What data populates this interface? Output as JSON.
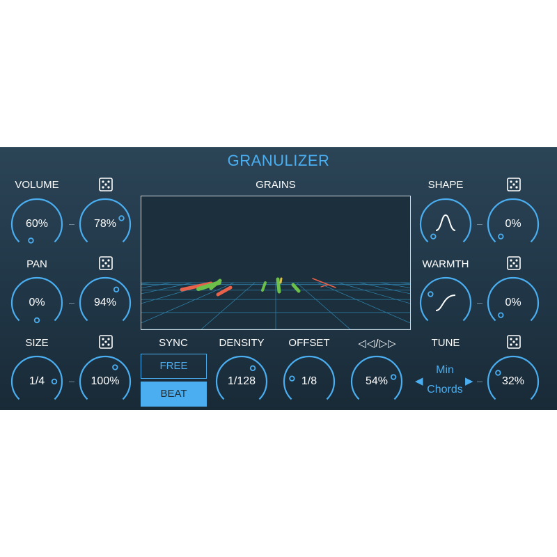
{
  "title": "GRANULIZER",
  "labels": {
    "volume": "VOLUME",
    "pan": "PAN",
    "size": "SIZE",
    "grains": "GRAINS",
    "shape": "SHAPE",
    "warmth": "WARMTH",
    "tune": "TUNE",
    "sync": "SYNC",
    "density": "DENSITY",
    "offset": "OFFSET",
    "direction": "◁◁/▷▷"
  },
  "knobs": {
    "volume": "60%",
    "volume_random": "78%",
    "pan": "0%",
    "pan_random": "94%",
    "size": "1/4",
    "size_random": "100%",
    "shape_random": "0%",
    "warmth_random": "0%",
    "tune_random": "32%",
    "density": "1/128",
    "offset": "1/8",
    "direction": "54%"
  },
  "sync": {
    "free": "FREE",
    "beat": "BEAT",
    "selected": "BEAT"
  },
  "tune": {
    "scale": "Min",
    "mode": "Chords"
  },
  "colors": {
    "accent": "#4aaef0",
    "background": "#22394a",
    "grain_green": "#6cc04a",
    "grain_red": "#e8614a"
  },
  "icons": {
    "dice": "dice-icon",
    "prev": "triangle-left-icon",
    "next": "triangle-right-icon"
  }
}
